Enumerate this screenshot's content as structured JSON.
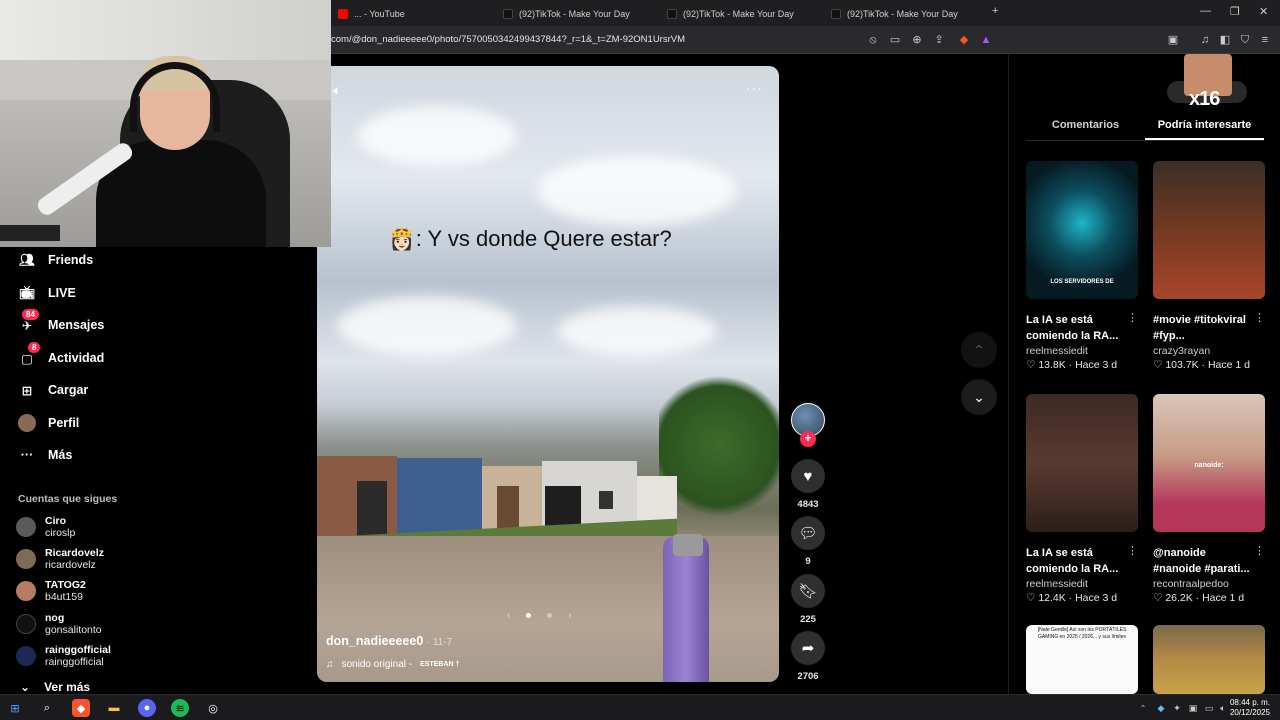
{
  "browser": {
    "tabs": [
      {
        "label": "... - YouTube"
      },
      {
        "label": "(92)TikTok - Make Your Day"
      },
      {
        "label": "(92)TikTok - Make Your Day"
      },
      {
        "label": "(92)TikTok - Make Your Day"
      }
    ],
    "url": "com/@don_nadieeeee0/photo/7570050342499437844?_r=1&_t=ZM-92ON1UrsrVM"
  },
  "sidebar": {
    "items": [
      {
        "label": "Friends"
      },
      {
        "label": "LIVE"
      },
      {
        "label": "Mensajes",
        "badge": "84"
      },
      {
        "label": "Actividad",
        "badge": "8"
      },
      {
        "label": "Cargar"
      },
      {
        "label": "Perfil"
      },
      {
        "label": "Más"
      }
    ],
    "following_title": "Cuentas que sigues",
    "following": [
      {
        "name": "Ciro",
        "user": "ciroslp"
      },
      {
        "name": "Ricardovelz",
        "user": "ricardovelz"
      },
      {
        "name": "TATOG2",
        "user": "b4ut159"
      },
      {
        "name": "nog",
        "user": "gonsalitonto"
      },
      {
        "name": "rainggofficial",
        "user": "rainggofficial"
      }
    ],
    "see_more": "Ver más"
  },
  "video": {
    "caption": ": Y vs donde Quere estar?",
    "author": "don_nadieeeee0",
    "date": "· 11-7",
    "sound": "sonido original -",
    "sound_artist": "ESTEBAN †"
  },
  "actions": {
    "likes": "4843",
    "comments": "9",
    "saves": "225",
    "shares": "2706"
  },
  "right_panel": {
    "overlay_text": "x16",
    "tabs": [
      "Comentarios",
      "Podría interesarte"
    ],
    "cards": [
      {
        "title": "La IA se está comiendo la RA...",
        "author": "reelmessiedit",
        "stats": "♡ 13.8K · Hace 3 d",
        "thumb_text": "LOS SERVIDORES DE"
      },
      {
        "title": "#movie #titokviral #fyp...",
        "author": "crazy3rayan",
        "stats": "♡ 103.7K · Hace 1 d",
        "thumb_text": ""
      },
      {
        "title": "La IA se está comiendo la RA...",
        "author": "reelmessiedit",
        "stats": "♡ 12.4K · Hace 3 d",
        "thumb_text": ""
      },
      {
        "title": "@nanoide #nanoide #parati...",
        "author": "recontraalpedoo",
        "stats": "♡ 26.2K · Hace 1 d",
        "thumb_text": "nanoide:"
      }
    ],
    "partial_thumb_text": "[Nate Gentile] Así son los PORTÁTILES GAMING en 2025 / 2026... y sus límites"
  },
  "taskbar": {
    "time": "08:44 p. m.",
    "date": "20/12/2025"
  }
}
